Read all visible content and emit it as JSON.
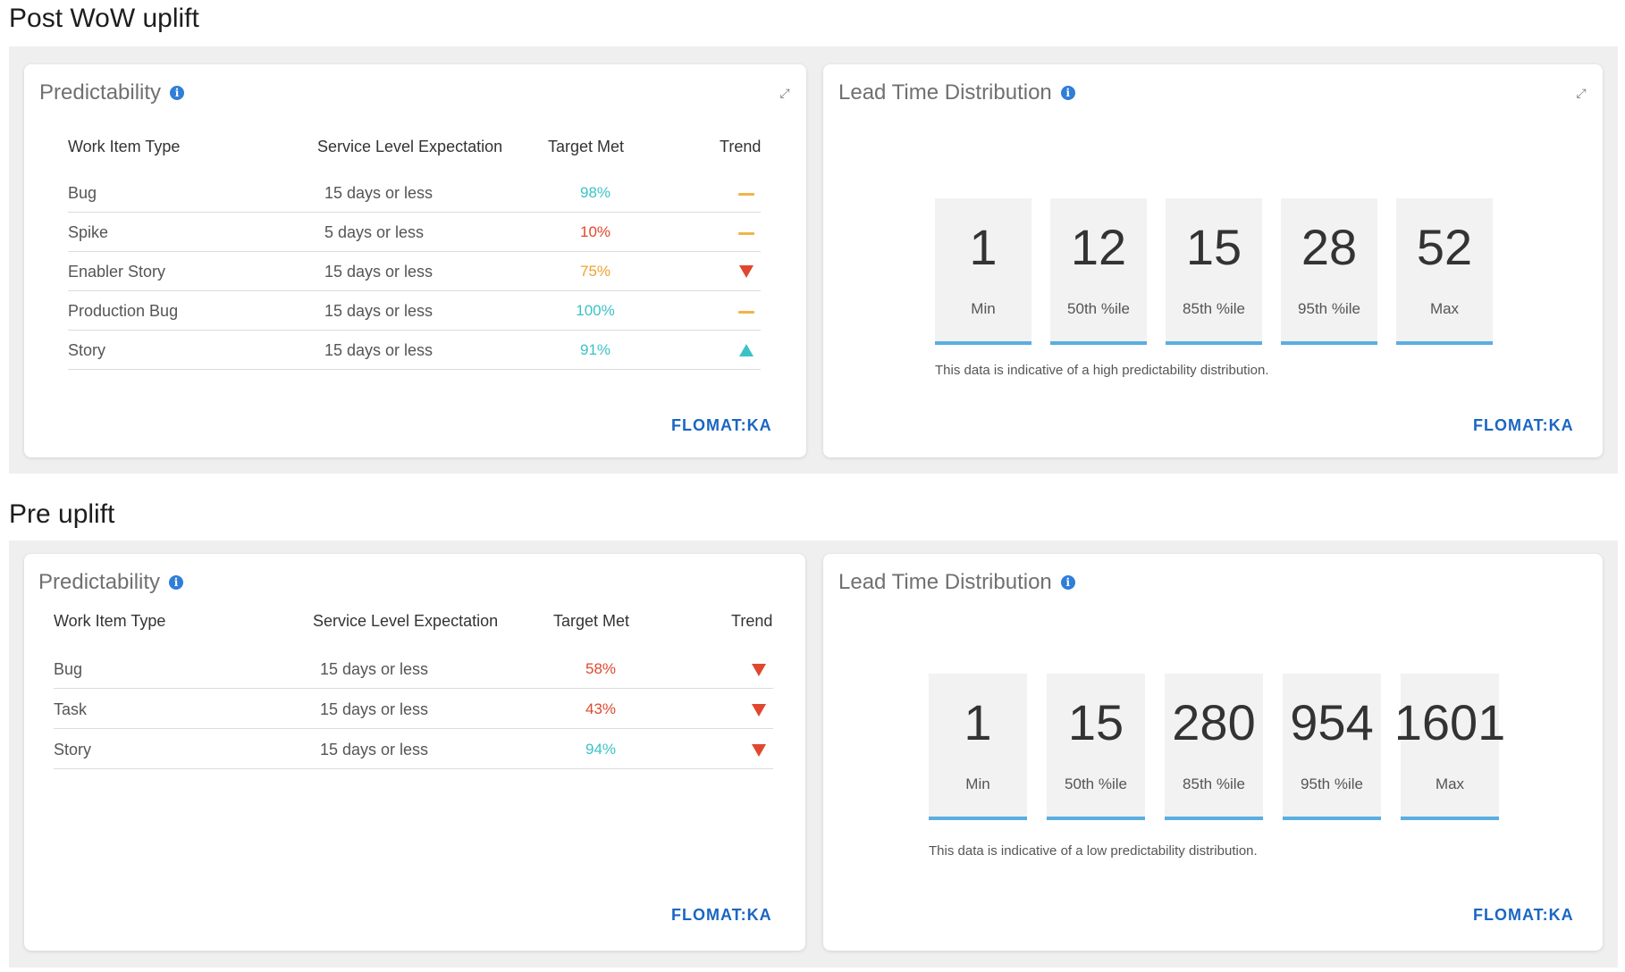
{
  "sections": [
    {
      "title": "Post WoW uplift",
      "predictability": {
        "title": "Predictability",
        "headers": [
          "Work Item Type",
          "Service Level Expectation",
          "Target Met",
          "Trend"
        ],
        "rows": [
          {
            "type": "Bug",
            "sle": "15 days or less",
            "target": "98%",
            "target_color": "#3cc2c6",
            "trend": "flat",
            "trend_color": "#f0b44a"
          },
          {
            "type": "Spike",
            "sle": "5 days or less",
            "target": "10%",
            "target_color": "#e0472e",
            "trend": "flat",
            "trend_color": "#f0b44a"
          },
          {
            "type": "Enabler Story",
            "sle": "15 days or less",
            "target": "75%",
            "target_color": "#f0a030",
            "trend": "down",
            "trend_color": "#e0472e"
          },
          {
            "type": "Production Bug",
            "sle": "15 days or less",
            "target": "100%",
            "target_color": "#3cc2c6",
            "trend": "flat",
            "trend_color": "#f0b44a"
          },
          {
            "type": "Story",
            "sle": "15 days or less",
            "target": "91%",
            "target_color": "#3cc2c6",
            "trend": "up",
            "trend_color": "#3cc2c6"
          }
        ],
        "logo": "FLOMAT:KA"
      },
      "lead_time": {
        "title": "Lead Time Distribution",
        "tiles": [
          {
            "value": "1",
            "label": "Min"
          },
          {
            "value": "12",
            "label": "50th %ile"
          },
          {
            "value": "15",
            "label": "85th %ile"
          },
          {
            "value": "28",
            "label": "95th %ile"
          },
          {
            "value": "52",
            "label": "Max"
          }
        ],
        "note": "This data is indicative of a high predictability distribution.",
        "logo": "FLOMAT:KA"
      }
    },
    {
      "title": "Pre uplift",
      "predictability": {
        "title": "Predictability",
        "headers": [
          "Work Item Type",
          "Service Level Expectation",
          "Target Met",
          "Trend"
        ],
        "rows": [
          {
            "type": "Bug",
            "sle": "15 days or less",
            "target": "58%",
            "target_color": "#e0472e",
            "trend": "down",
            "trend_color": "#e0472e"
          },
          {
            "type": "Task",
            "sle": "15 days or less",
            "target": "43%",
            "target_color": "#e0472e",
            "trend": "down",
            "trend_color": "#e0472e"
          },
          {
            "type": "Story",
            "sle": "15 days or less",
            "target": "94%",
            "target_color": "#3cc2c6",
            "trend": "down",
            "trend_color": "#e0472e"
          }
        ],
        "logo": "FLOMAT:KA"
      },
      "lead_time": {
        "title": "Lead Time Distribution",
        "tiles": [
          {
            "value": "1",
            "label": "Min"
          },
          {
            "value": "15",
            "label": "50th %ile"
          },
          {
            "value": "280",
            "label": "85th %ile"
          },
          {
            "value": "954",
            "label": "95th %ile"
          },
          {
            "value": "1601",
            "label": "Max"
          }
        ],
        "note": "This data is indicative of a low predictability distribution.",
        "logo": "FLOMAT:KA"
      }
    }
  ]
}
